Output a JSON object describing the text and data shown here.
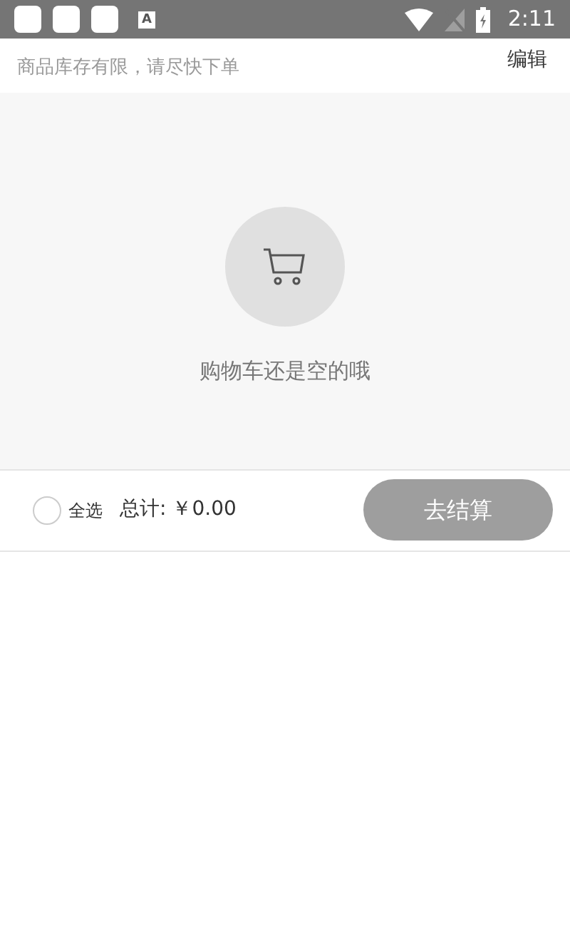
{
  "status_bar": {
    "notification_letter": "A",
    "time": "2:11"
  },
  "header": {
    "notice": "商品库存有限，请尽快下单",
    "edit": "编辑"
  },
  "empty_state": {
    "message": "购物车还是空的哦"
  },
  "footer": {
    "select_all": {
      "label": "全选",
      "checked": false
    },
    "total_label": "总计:",
    "total": "￥0.00",
    "checkout": "去结算"
  }
}
